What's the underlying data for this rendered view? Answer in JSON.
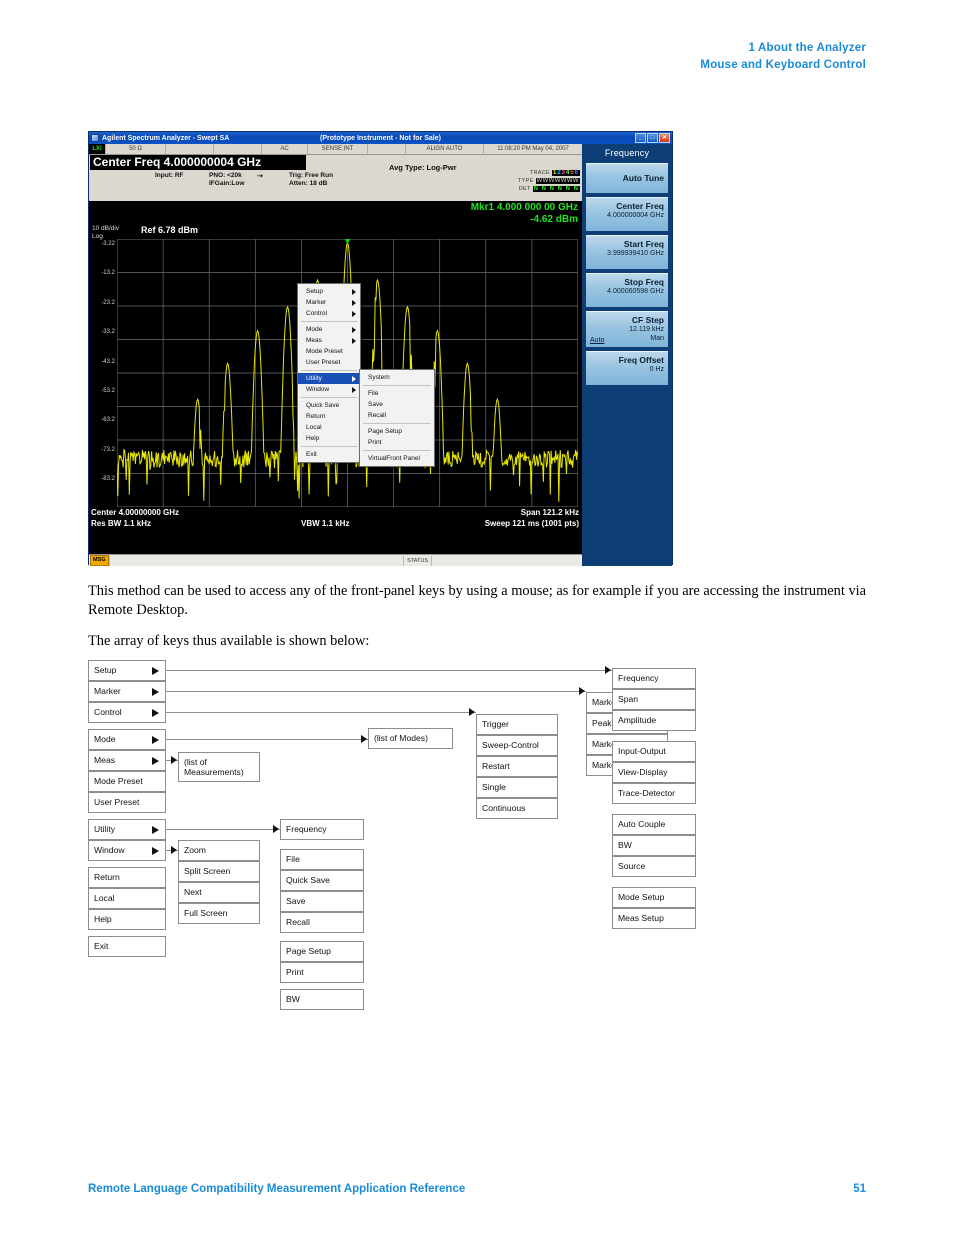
{
  "page_header": {
    "line1": "1  About the Analyzer",
    "line2": "Mouse and Keyboard Control"
  },
  "instrument": {
    "window_title": "Agilent Spectrum Analyzer - Swept SA",
    "window_subtitle": "(Prototype Instrument - Not for Sale)",
    "window_buttons": {
      "minimize": "_",
      "maximize": "□",
      "close": "✕"
    },
    "annotation_row": {
      "alc": "LXI",
      "impedance": "50 Ω",
      "coupling": "AC",
      "sense": "SENSE:INT",
      "align": "ALIGN AUTO",
      "datetime": "11:08:20 PM May 04, 2007"
    },
    "center_freq_box": "Center Freq  4.000000004 GHz",
    "header_labels": {
      "input": "Input: RF",
      "pno": "PNO: <20k",
      "ifgain": "IFGain:Low",
      "trig": "Trig: Free Run",
      "atten": "Atten: 18 dB",
      "avg_type": "Avg Type: Log-Pwr"
    },
    "trace_block": {
      "trace_key": "TRACE",
      "type_key": "TYPE",
      "det_key": "DET",
      "trace_numbers": [
        "1",
        "2",
        "3",
        "4",
        "5",
        "6"
      ],
      "type_value": "WWWWWWW",
      "det_value": "N N N N N N"
    },
    "graph": {
      "div_label": "10 dB/div",
      "scale_label": "Log",
      "ref_label": "Ref 6.78 dBm",
      "marker_line1": "Mkr1 4.000 000 00 GHz",
      "marker_line2": "-4.62 dBm",
      "marker_number": "1",
      "y_labels": [
        "-3.22",
        "-13.2",
        "-23.2",
        "-33.2",
        "-43.2",
        "-53.2",
        "-63.2",
        "-73.2",
        "-83.2"
      ],
      "footer": {
        "center": "Center 4.00000000 GHz",
        "span": "Span 121.2 kHz",
        "res_bw": "Res BW 1.1 kHz",
        "vbw": "VBW 1.1 kHz",
        "sweep": "Sweep  121 ms (1001 pts)"
      },
      "colors": {
        "trace": "#e8e800",
        "marker": "#00e000",
        "grid": "#6e6e6e",
        "background": "#000000"
      }
    },
    "status_bar": {
      "msg": "MSG",
      "status": "STATUS"
    },
    "softkeys": {
      "title": "Frequency",
      "items": [
        {
          "label": "Auto Tune",
          "value": ""
        },
        {
          "label": "Center Freq",
          "value": "4.000000004 GHz"
        },
        {
          "label": "Start Freq",
          "value": "3.999939410 GHz"
        },
        {
          "label": "Stop Freq",
          "value": "4.000060598 GHz"
        },
        {
          "label": "CF Step",
          "value": "12.119 kHz",
          "auto": "Auto",
          "man": "Man"
        },
        {
          "label": "Freq Offset",
          "value": "0 Hz"
        }
      ]
    },
    "context_menu": {
      "groups": [
        [
          "Setup",
          "Marker",
          "Control"
        ],
        [
          "Mode",
          "Meas",
          "Mode Preset",
          "User Preset"
        ],
        [
          "Utility",
          "Window"
        ],
        [
          "Quick Save",
          "Return",
          "Local",
          "Help"
        ],
        [
          "Exit"
        ]
      ],
      "submenu_items": [
        "Setup",
        "Marker",
        "Control",
        "Mode",
        "Meas",
        "Utility",
        "Window"
      ],
      "selected": "Utility",
      "submenu": {
        "groups": [
          [
            "System"
          ],
          [
            "File",
            "Save",
            "Recall"
          ],
          [
            "Page Setup",
            "Print"
          ],
          [
            "VirtualFront Panel"
          ]
        ]
      }
    }
  },
  "body_text": {
    "para1": "This method can be used to access any of the front-panel keys by using a mouse; as for example if you are accessing the instrument via Remote Desktop.",
    "para2": "The array of keys thus available is shown below:"
  },
  "diagram": {
    "col1": {
      "group1": [
        "Setup",
        "Marker",
        "Control"
      ],
      "group2": [
        "Mode",
        "Meas",
        "Mode Preset",
        "User Preset"
      ],
      "group3": [
        "Utility",
        "Window"
      ],
      "group4": [
        "Return",
        "Local",
        "Help"
      ],
      "group5": [
        "Exit"
      ],
      "arrow_items": [
        "Setup",
        "Marker",
        "Control",
        "Mode",
        "Meas",
        "Utility",
        "Window"
      ]
    },
    "col2": {
      "measurements": "(list of\nMeasurements)",
      "window_group": [
        "Zoom",
        "Split Screen",
        "Next",
        "Full Screen"
      ]
    },
    "col3": {
      "modes": "(list of Modes)",
      "utility_freq": [
        "Frequency"
      ],
      "file_group": [
        "File",
        "Quick Save",
        "Save",
        "Recall"
      ],
      "print_group": [
        "Page Setup",
        "Print"
      ],
      "bw_group": [
        "BW"
      ]
    },
    "col4": {
      "control_group": [
        "Trigger",
        "Sweep-Control",
        "Restart",
        "Single",
        "Continuous"
      ]
    },
    "col5": {
      "marker_group": [
        "Marker",
        "Peak Search",
        "Marker To",
        "Marker Function"
      ]
    },
    "col6": {
      "group1": [
        "Frequency",
        "Span",
        "Amplitude"
      ],
      "group2": [
        "Input-Output",
        "View-Display",
        "Trace-Detector"
      ],
      "group3": [
        "Auto Couple",
        "BW",
        "Source"
      ],
      "group4": [
        "Mode Setup",
        "Meas Setup"
      ]
    }
  },
  "page_footer": {
    "left": "Remote Language Compatibility Measurement Application Reference",
    "right": "51"
  }
}
